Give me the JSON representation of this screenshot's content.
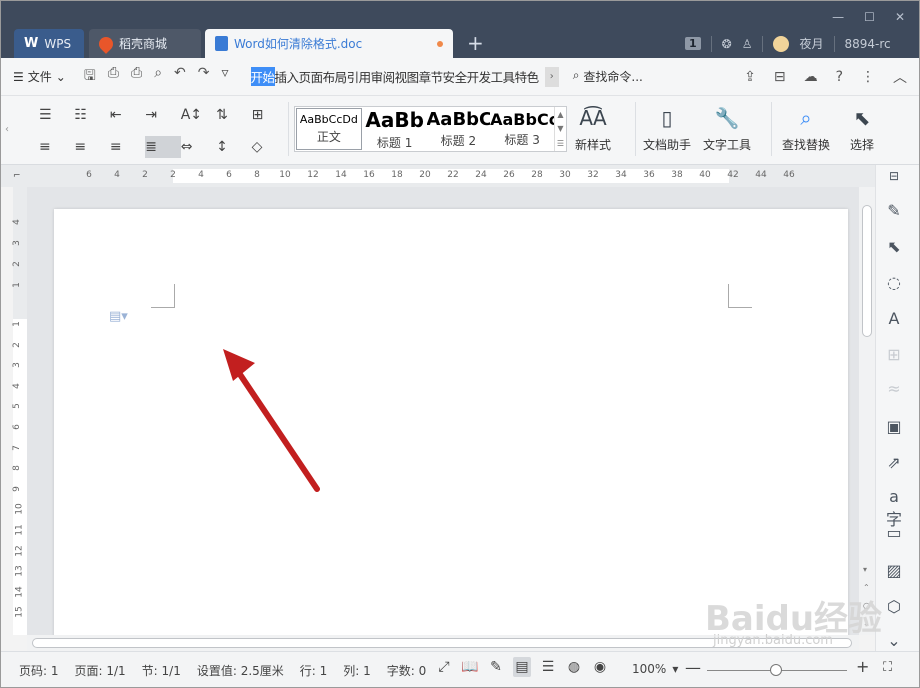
{
  "tabs": [
    {
      "label": "WPS"
    },
    {
      "label": "稻壳商城"
    },
    {
      "label": "Word如何清除格式.doc"
    }
  ],
  "titlebar": {
    "badge": "1",
    "user": "夜月",
    "account": "8894-rc",
    "new_tab": "+"
  },
  "quickbar": {
    "file": "文件",
    "search": "查找命令...",
    "menu": [
      "开始",
      "插入",
      "页面布局",
      "引用",
      "审阅",
      "视图",
      "章节",
      "安全",
      "开发工具",
      "特色"
    ]
  },
  "styles": [
    {
      "preview": "AaBbCcDd",
      "label": "正文"
    },
    {
      "preview": "AaBb",
      "label": "标题 1"
    },
    {
      "preview": "AaBbC",
      "label": "标题 2"
    },
    {
      "preview": "AaBbCc",
      "label": "标题 3"
    }
  ],
  "ribbon": {
    "new_style": "新样式",
    "doc_helper": "文档助手",
    "text_tools": "文字工具",
    "find_replace": "查找替换",
    "select": "选择"
  },
  "ruler": {
    "h": [
      "6",
      "4",
      "2",
      "2",
      "4",
      "6",
      "8",
      "10",
      "12",
      "14",
      "16",
      "18",
      "20",
      "22",
      "24",
      "26",
      "28",
      "30",
      "32",
      "34",
      "36",
      "38",
      "40",
      "42",
      "44",
      "46"
    ],
    "v_top": [
      "4",
      "3",
      "2",
      "1"
    ],
    "v_bottom": [
      "1",
      "2",
      "3",
      "4",
      "5",
      "6",
      "7",
      "8",
      "9",
      "10",
      "11",
      "12",
      "13",
      "14",
      "15"
    ]
  },
  "status": {
    "page_no": "页码: 1",
    "pages": "页面: 1/1",
    "section": "节: 1/1",
    "setting": "设置值: 2.5厘米",
    "row": "行: 1",
    "col": "列: 1",
    "words": "字数: 0",
    "zoom": "100%"
  },
  "watermark": {
    "brand": "Baidu经验",
    "url": "jingyan.baidu.com"
  }
}
